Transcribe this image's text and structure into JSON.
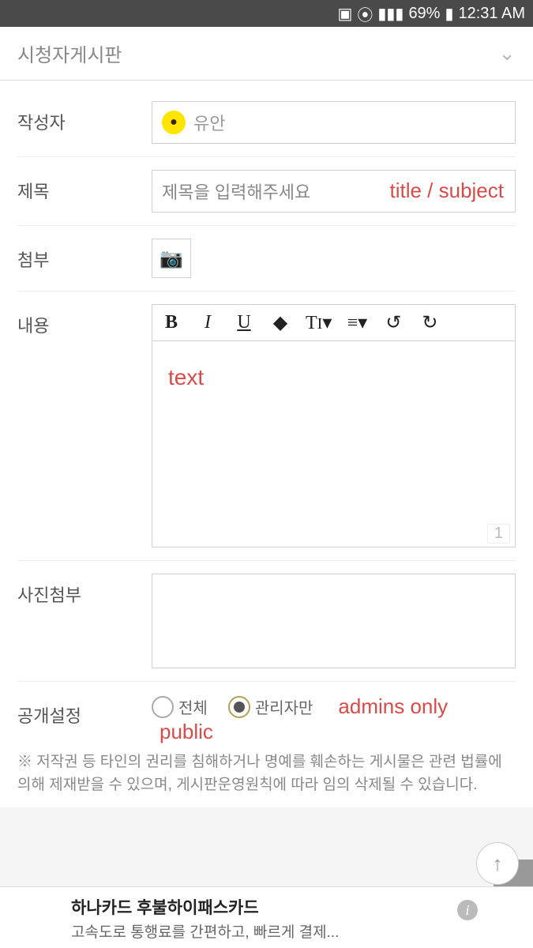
{
  "status": {
    "battery_pct": "69%",
    "time": "12:31 AM"
  },
  "header": {
    "title": "시청자게시판"
  },
  "form": {
    "author": {
      "label": "작성자",
      "value": "유안"
    },
    "subject": {
      "label": "제목",
      "placeholder": "제목을 입력해주세요",
      "annotation": "title / subject"
    },
    "attach": {
      "label": "첨부"
    },
    "content": {
      "label": "내용",
      "annotation": "text",
      "page": "1"
    },
    "photo": {
      "label": "사진첨부"
    },
    "visibility": {
      "label": "공개설정",
      "options": [
        {
          "label": "전체",
          "selected": false,
          "annotation": "public"
        },
        {
          "label": "관리자만",
          "selected": true,
          "annotation": "admins only"
        }
      ]
    }
  },
  "notice": "저작권 등 타인의 권리를 침해하거나 명예를 훼손하는 게시물은 관련 법률에 의해 제재받을 수 있으며, 게시판운영원칙에 따라 임의 삭제될 수 있습니다.",
  "ad": {
    "title": "하나카드 후불하이패스카드",
    "subtitle": "고속도로 통행료를 간편하고, 빠르게 결제..."
  }
}
